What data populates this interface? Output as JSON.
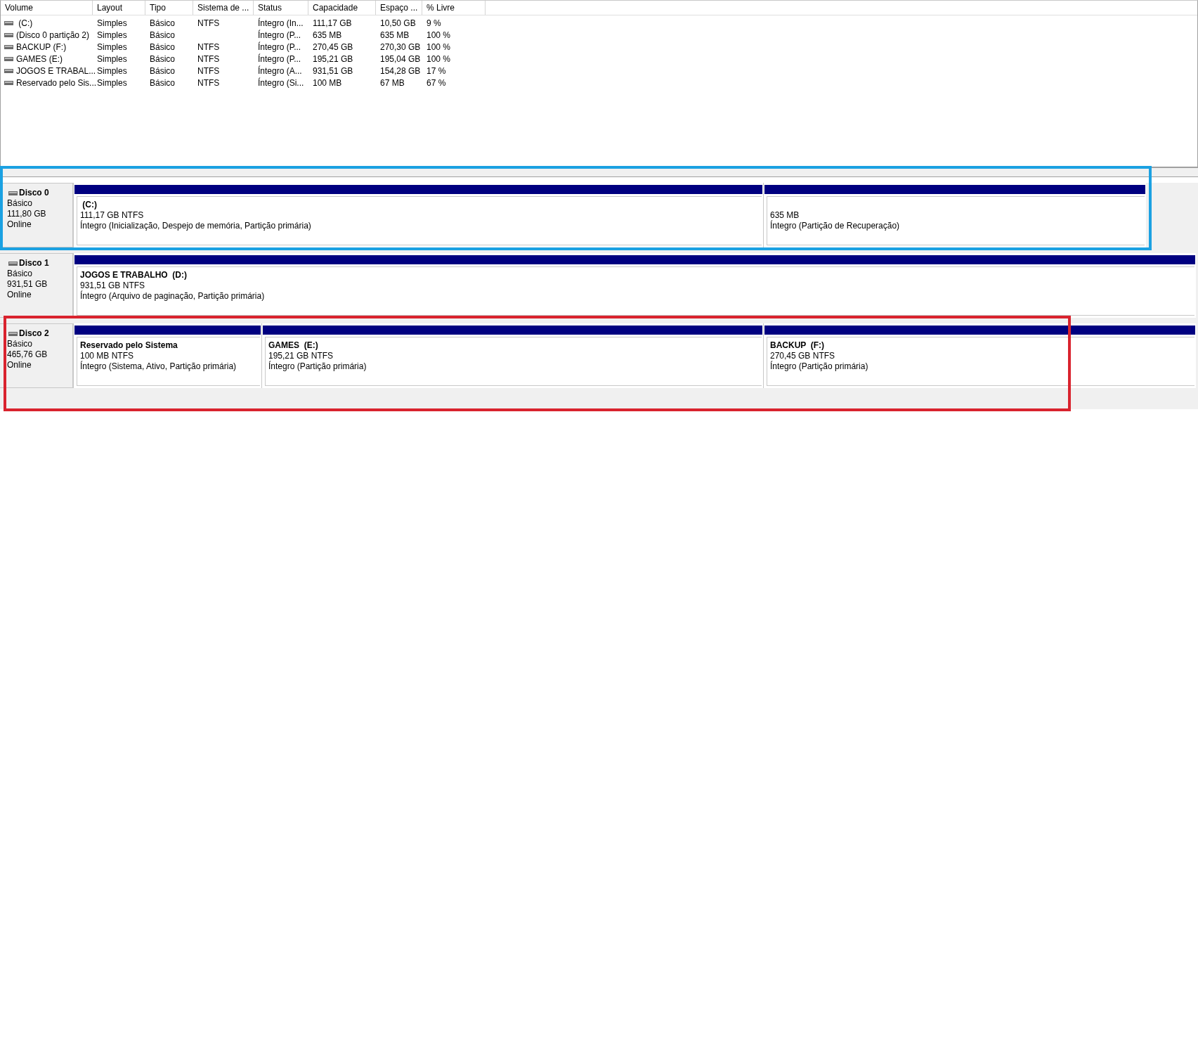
{
  "volume_table": {
    "columns": [
      "Volume",
      "Layout",
      "Tipo",
      "Sistema de ...",
      "Status",
      "Capacidade",
      "Espaço ...",
      "% Livre"
    ],
    "rows": [
      {
        "cells": [
          " (C:)",
          "Simples",
          "Básico",
          "NTFS",
          "Íntegro (In...",
          "111,17 GB",
          "10,50 GB",
          "9 %"
        ]
      },
      {
        "cells": [
          "(Disco 0 partição 2)",
          "Simples",
          "Básico",
          "",
          "Íntegro (P...",
          "635 MB",
          "635 MB",
          "100 %"
        ]
      },
      {
        "cells": [
          "BACKUP (F:)",
          "Simples",
          "Básico",
          "NTFS",
          "Íntegro (P...",
          "270,45 GB",
          "270,30 GB",
          "100 %"
        ]
      },
      {
        "cells": [
          "GAMES (E:)",
          "Simples",
          "Básico",
          "NTFS",
          "Íntegro (P...",
          "195,21 GB",
          "195,04 GB",
          "100 %"
        ]
      },
      {
        "cells": [
          "JOGOS E TRABAL...",
          "Simples",
          "Básico",
          "NTFS",
          "Íntegro (A...",
          "931,51 GB",
          "154,28 GB",
          "17 %"
        ]
      },
      {
        "cells": [
          "Reservado pelo Sis...",
          "Simples",
          "Básico",
          "NTFS",
          "Íntegro (Si...",
          "100 MB",
          "67 MB",
          "67 %"
        ]
      }
    ]
  },
  "disks": [
    {
      "name": "Disco 0",
      "type": "Básico",
      "size": "111,80 GB",
      "status": "Online",
      "color": "#1ba1e2",
      "partitions": [
        {
          "name": " (C:)",
          "size": "111,17 GB NTFS",
          "status": "Íntegro (Inicialização, Despejo de memória, Partição primária)"
        },
        {
          "size": "635 MB",
          "status": "Íntegro (Partição de Recuperação)"
        }
      ]
    },
    {
      "name": "Disco 1",
      "type": "Básico",
      "size": "931,51 GB",
      "status": "Online",
      "partitions": [
        {
          "name": "JOGOS E TRABALHO  (D:)",
          "size": "931,51 GB NTFS",
          "status": "Íntegro (Arquivo de paginação, Partição primária)"
        }
      ]
    },
    {
      "name": "Disco 2",
      "type": "Básico",
      "size": "465,76 GB",
      "status": "Online",
      "color": "#d9232e",
      "partitions": [
        {
          "name": "Reservado pelo Sistema",
          "size": "100 MB NTFS",
          "status": "Íntegro (Sistema, Ativo, Partição primária)"
        },
        {
          "name": "GAMES  (E:)",
          "size": "195,21 GB NTFS",
          "status": "Íntegro (Partição primária)"
        },
        {
          "name": "BACKUP  (F:)",
          "size": "270,45 GB NTFS",
          "status": "Íntegro (Partição primária)"
        }
      ]
    }
  ]
}
